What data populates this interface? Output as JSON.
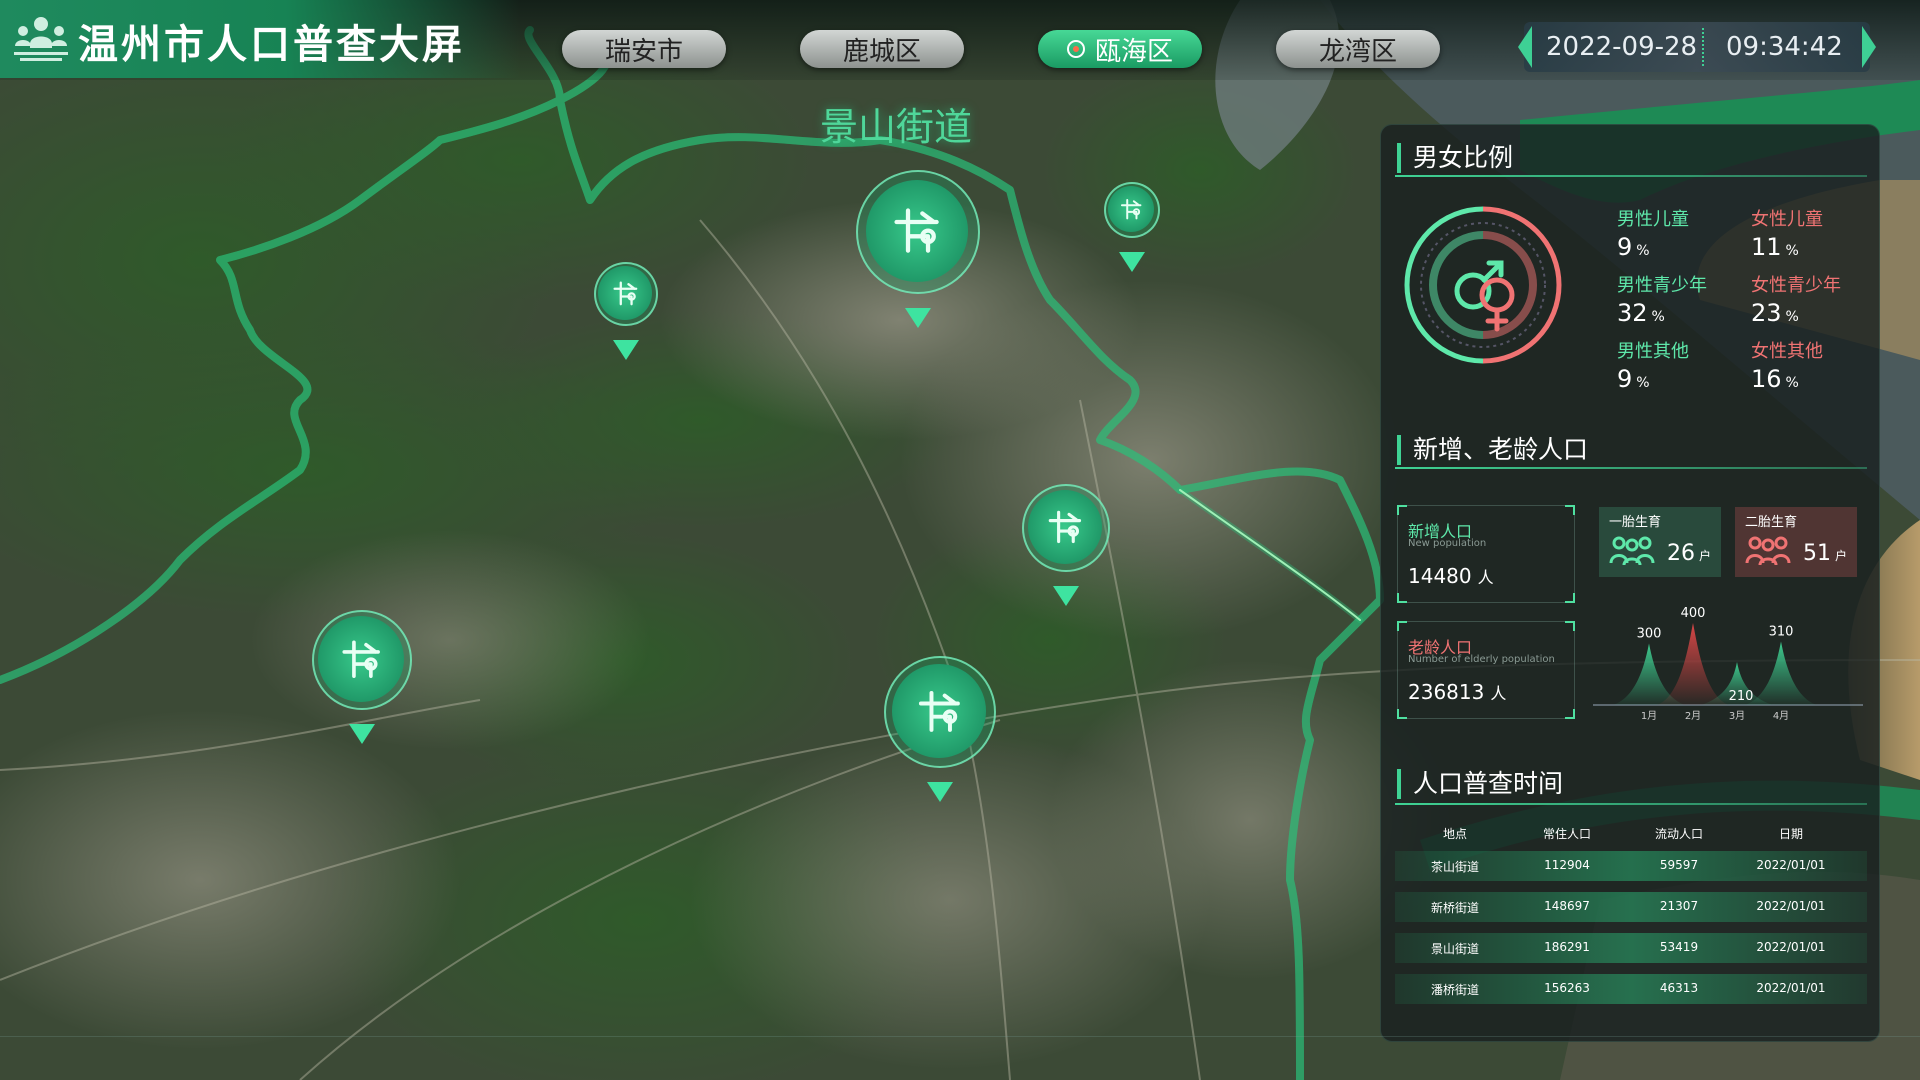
{
  "header": {
    "title": "温州市人口普查大屏",
    "tabs": [
      {
        "label": "瑞安市",
        "active": false
      },
      {
        "label": "鹿城区",
        "active": false
      },
      {
        "label": "瓯海区",
        "active": true
      },
      {
        "label": "龙湾区",
        "active": false
      }
    ],
    "date": "2022-09-28",
    "time": "09:34:42"
  },
  "map": {
    "street_label": "景山街道",
    "marker_icon": "network-node-icon",
    "accent_color": "#3fd394"
  },
  "gender_ratio": {
    "title": "男女比例",
    "center_icon": "gender-symbol-icon",
    "male_color": "#5ee8aa",
    "female_color": "#f07373",
    "unit": "%",
    "items": [
      {
        "label": "男性儿童",
        "value": "9",
        "gender": "male"
      },
      {
        "label": "女性儿童",
        "value": "11",
        "gender": "female"
      },
      {
        "label": "男性青少年",
        "value": "32",
        "gender": "male"
      },
      {
        "label": "女性青少年",
        "value": "23",
        "gender": "female"
      },
      {
        "label": "男性其他",
        "value": "9",
        "gender": "male"
      },
      {
        "label": "女性其他",
        "value": "16",
        "gender": "female"
      }
    ]
  },
  "population": {
    "title": "新增、老龄人口",
    "new": {
      "label": "新增人口",
      "sub": "New population",
      "value": "14480",
      "unit": "人"
    },
    "elderly": {
      "label": "老龄人口",
      "sub": "Number of elderly population",
      "value": "236813",
      "unit": "人"
    },
    "first_birth": {
      "label": "一胎生育",
      "value": "26",
      "unit": "户",
      "icon": "family-icon"
    },
    "second_birth": {
      "label": "二胎生育",
      "value": "51",
      "unit": "户",
      "icon": "family-icon"
    }
  },
  "chart_data": {
    "type": "area",
    "categories": [
      "1月",
      "2月",
      "3月",
      "4月"
    ],
    "values": [
      300,
      400,
      210,
      310
    ],
    "highlight_index": 1,
    "colors": {
      "normal": "#3fd394",
      "highlight": "#e04848"
    },
    "title": "",
    "ylim": [
      0,
      400
    ]
  },
  "census": {
    "title": "人口普查时间",
    "columns": [
      "地点",
      "常住人口",
      "流动人口",
      "日期"
    ],
    "rows": [
      [
        "茶山街道",
        "112904",
        "59597",
        "2022/01/01"
      ],
      [
        "新桥街道",
        "148697",
        "21307",
        "2022/01/01"
      ],
      [
        "景山街道",
        "186291",
        "53419",
        "2022/01/01"
      ],
      [
        "潘桥街道",
        "156263",
        "46313",
        "2022/01/01"
      ]
    ]
  }
}
